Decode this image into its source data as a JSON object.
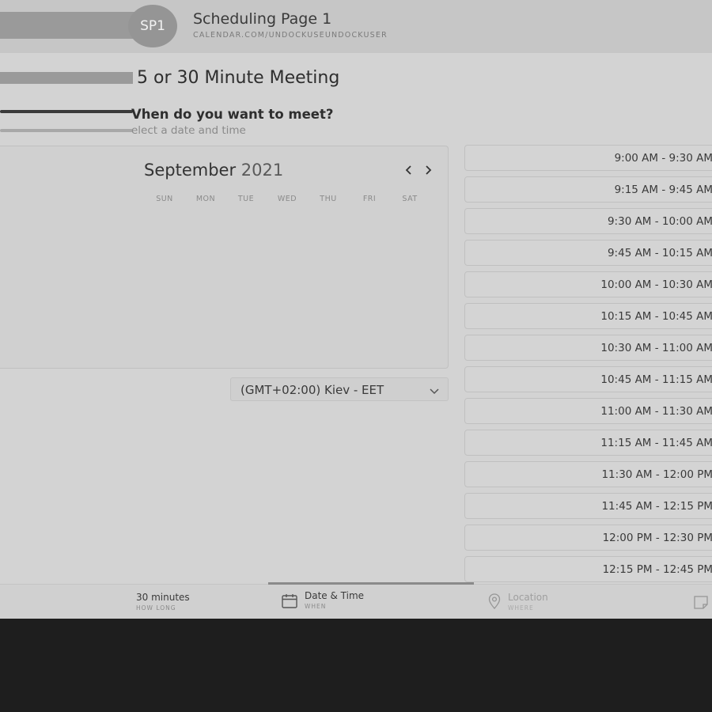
{
  "header": {
    "avatar_initials": "SP1",
    "title": "Scheduling Page 1",
    "subtitle": "CALENDAR.COM/UNDOCKUSEUNDOCKUSER"
  },
  "meeting": {
    "title": "5 or 30 Minute Meeting",
    "question": "Vhen do you want to meet?",
    "hint": "elect a date and time"
  },
  "calendar": {
    "month": "September",
    "year": "2021",
    "prev_icon": "chevron-left-icon",
    "next_icon": "chevron-right-icon",
    "weekdays": [
      "SUN",
      "MON",
      "TUE",
      "WED",
      "THU",
      "FRI",
      "SAT"
    ]
  },
  "timezone": {
    "value": "(GMT+02:00) Kiev - EET",
    "icon": "chevron-down-icon"
  },
  "slots": [
    "9:00 AM - 9:30 AM",
    "9:15 AM - 9:45 AM",
    "9:30 AM - 10:00 AM",
    "9:45 AM - 10:15 AM",
    "10:00 AM - 10:30 AM",
    "10:15 AM - 10:45 AM",
    "10:30 AM - 11:00 AM",
    "10:45 AM - 11:15 AM",
    "11:00 AM - 11:30 AM",
    "11:15 AM - 11:45 AM",
    "11:30 AM - 12:00 PM",
    "11:45 AM - 12:15 PM",
    "12:00 PM - 12:30 PM",
    "12:15 PM - 12:45 PM"
  ],
  "footer": {
    "duration": {
      "label": "30 minutes",
      "sub": "HOW LONG"
    },
    "datetime": {
      "label": "Date & Time",
      "sub": "WHEN",
      "icon": "calendar-icon"
    },
    "location": {
      "label": "Location",
      "sub": "WHERE",
      "icon": "location-pin-icon"
    },
    "notes_icon": "note-icon"
  },
  "colors": {
    "page_bg": "#d3d3d3",
    "header_bg": "#c6c6c6",
    "outer_bg": "#1e1e1e",
    "avatar_bg": "#959595"
  }
}
